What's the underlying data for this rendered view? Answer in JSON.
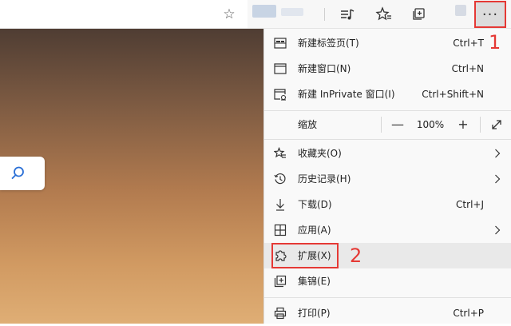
{
  "menu": {
    "new_tab": {
      "label": "新建标签页(T)",
      "shortcut": "Ctrl+T"
    },
    "new_window": {
      "label": "新建窗口(N)",
      "shortcut": "Ctrl+N"
    },
    "new_inprivate": {
      "label": "新建 InPrivate 窗口(I)",
      "shortcut": "Ctrl+Shift+N"
    },
    "zoom": {
      "label": "缩放",
      "minus": "—",
      "value": "100%",
      "plus": "+"
    },
    "favorites": {
      "label": "收藏夹(O)"
    },
    "history": {
      "label": "历史记录(H)"
    },
    "downloads": {
      "label": "下载(D)",
      "shortcut": "Ctrl+J"
    },
    "apps": {
      "label": "应用(A)"
    },
    "extensions": {
      "label": "扩展(X)"
    },
    "collections": {
      "label": "集锦(E)"
    },
    "print": {
      "label": "打印(P)",
      "shortcut": "Ctrl+P"
    }
  },
  "toolbar": {
    "more_label": "···"
  },
  "annotations": {
    "step1": "1",
    "step2": "2"
  },
  "icons": [
    "star-icon",
    "reading-list-icon",
    "favorites-icon",
    "collections-icon",
    "more-icon",
    "search-icon",
    "new-tab-icon",
    "new-window-icon",
    "inprivate-icon",
    "fullscreen-icon",
    "favorites-star-icon",
    "history-icon",
    "download-icon",
    "apps-icon",
    "extensions-icon",
    "collections-menu-icon",
    "print-icon",
    "chevron-right-icon"
  ],
  "colors": {
    "annotation": "#e53935",
    "highlight": "#e9e9e9"
  }
}
